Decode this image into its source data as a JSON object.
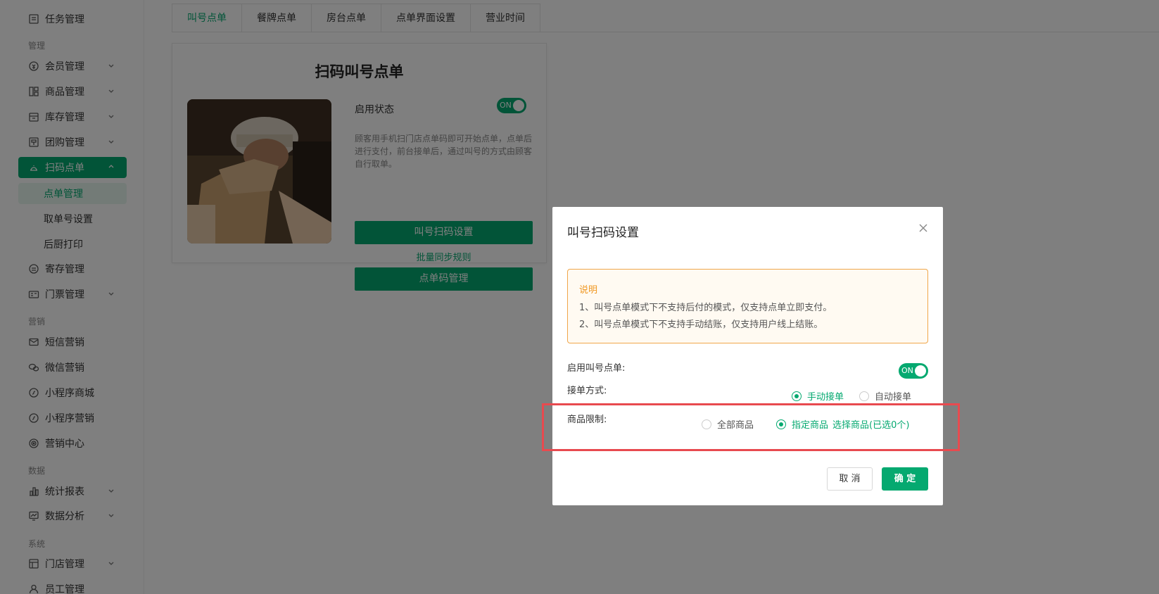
{
  "sidebar": {
    "top_item": "任务管理",
    "groups": {
      "manage": "管理",
      "marketing": "营销",
      "data": "数据",
      "system": "系统"
    },
    "items": {
      "member": "会员管理",
      "goods": "商品管理",
      "stock": "库存管理",
      "group": "团购管理",
      "scan": "扫码点单",
      "storage": "寄存管理",
      "ticket": "门票管理",
      "sms": "短信营销",
      "wechat": "微信营销",
      "mini_mall": "小程序商城",
      "mini_marketing": "小程序营销",
      "marketing_center": "营销中心",
      "report": "统计报表",
      "analysis": "数据分析",
      "store": "门店管理",
      "staff": "员工管理"
    },
    "sub_items": {
      "order_manage": "点单管理",
      "pickup_setting": "取单号设置",
      "kitchen_print": "后厨打印"
    }
  },
  "tabs": [
    "叫号点单",
    "餐牌点单",
    "房台点单",
    "点单界面设置",
    "营业时间"
  ],
  "card": {
    "title": "扫码叫号点单",
    "status_label": "启用状态",
    "toggle_text": "ON",
    "description": "顾客用手机扫门店点单码即可开始点单，点单后进行支付，前台接单后，通过叫号的方式由顾客自行取单。",
    "btn_scan_setting": "叫号扫码设置",
    "link_sync": "批量同步规则",
    "btn_code_manage": "点单码管理"
  },
  "modal": {
    "title": "叫号扫码设置",
    "notice_title": "说明",
    "notice_line1": "1、叫号点单模式下不支持后付的模式，仅支持点单立即支付。",
    "notice_line2": "2、叫号点单模式下不支持手动结账，仅支持用户线上结账。",
    "enable_label": "启用叫号点单:",
    "enable_toggle": "ON",
    "accept_label": "接单方式:",
    "accept_manual": "手动接单",
    "accept_auto": "自动接单",
    "goods_label": "商品限制:",
    "goods_all": "全部商品",
    "goods_specified": "指定商品",
    "goods_select_link": "选择商品(已选0个)",
    "cancel": "取 消",
    "confirm": "确 定"
  },
  "colors": {
    "accent": "#05a970",
    "notice_border": "#f0a64a",
    "highlight": "#e84a4f"
  }
}
